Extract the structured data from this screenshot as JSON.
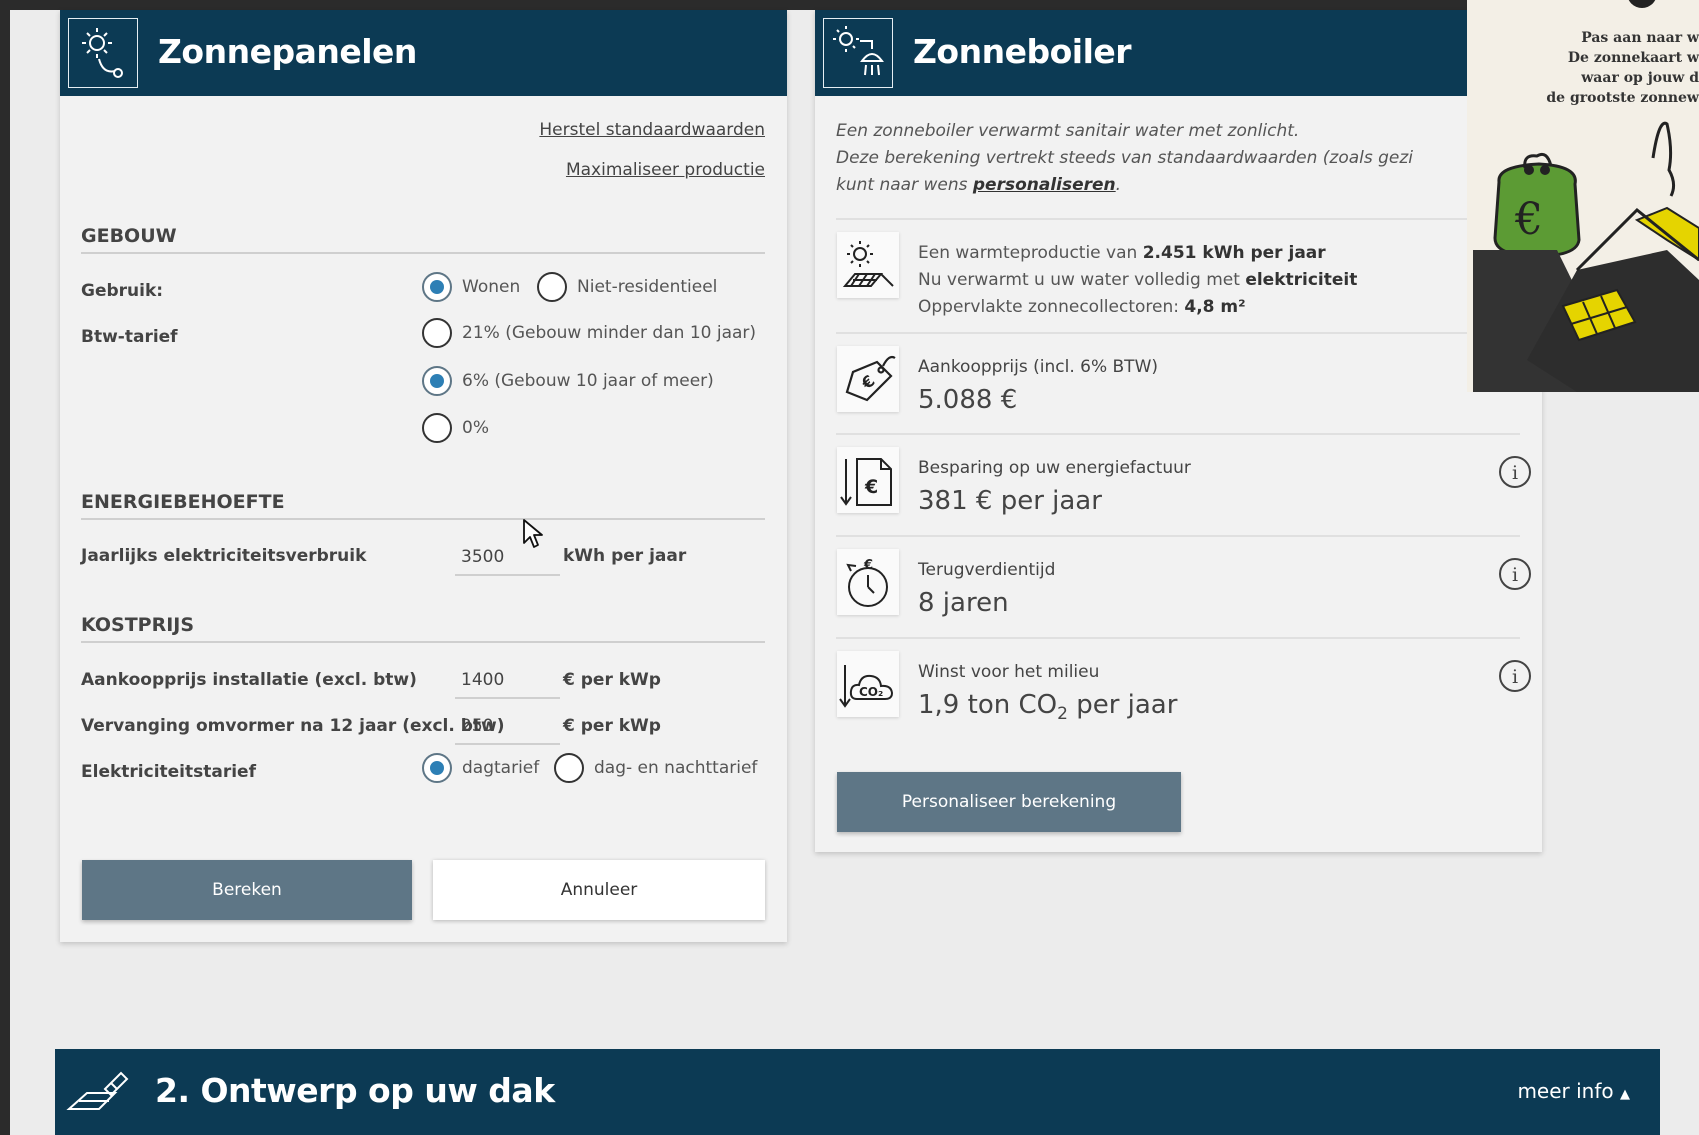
{
  "colors": {
    "navy": "#0c3a54",
    "button_blue": "#5e7686",
    "radio_blue": "#2d7fb5",
    "panel_bg": "#f2f2f2"
  },
  "zonnepanelen": {
    "title": "Zonnepanelen",
    "header_icon": "sun-plug-icon",
    "reset_link": "Herstel standaardwaarden",
    "maximize_link": "Maximaliseer productie",
    "gebouw": {
      "heading": "GEBOUW",
      "usage_label": "Gebruik:",
      "usage_options": [
        "Wonen",
        "Niet-residentieel"
      ],
      "usage_selected": "Wonen",
      "vat_label": "Btw-tarief",
      "vat_options": [
        "21% (Gebouw minder dan 10 jaar)",
        "6% (Gebouw 10 jaar of meer)",
        "0%"
      ],
      "vat_selected": "6% (Gebouw 10 jaar of meer)"
    },
    "energie": {
      "heading": "ENERGIEBEHOEFTE",
      "consumption_label": "Jaarlijks elektriciteitsverbruik",
      "consumption_value": "3500",
      "consumption_unit": "kWh per jaar"
    },
    "kostprijs": {
      "heading": "KOSTPRIJS",
      "install_label": "Aankoopprijs installatie (excl. btw)",
      "install_value": "1400",
      "install_unit": "€ per kWp",
      "inverter_label": "Vervanging omvormer na 12 jaar (excl. btw)",
      "inverter_value": "250",
      "inverter_unit": "€ per kWp",
      "tariff_label": "Elektriciteitstarief",
      "tariff_options": [
        "dagtarief",
        "dag- en nachttarief"
      ],
      "tariff_selected": "dagtarief"
    },
    "calc_button": "Bereken",
    "cancel_button": "Annuleer"
  },
  "zonneboiler": {
    "title": "Zonneboiler",
    "header_icon": "sun-boiler-icon",
    "intro_line1": "Een zonneboiler verwarmt sanitair water met zonlicht.",
    "intro_line2": "Deze berekening vertrekt steeds van standaardwaarden (zoals gezi",
    "intro_line3_prefix": "kunt naar wens ",
    "intro_link": "personaliseren",
    "intro_line3_suffix": ".",
    "production": {
      "icon": "sun-collector-icon",
      "prefix": "Een warmteproductie van ",
      "value": "2.451",
      "unit": "kWh per jaar",
      "heating_prefix": "Nu verwarmt u uw water volledig met ",
      "heating_source": "elektriciteit",
      "area_prefix": "Oppervlakte zonnecollectoren: ",
      "area_value": "4,8",
      "area_unit": "m²"
    },
    "results": [
      {
        "icon": "price-tag-euro-icon",
        "label": "Aankoopprijs (incl. 6% BTW)",
        "value": "5.088  €"
      },
      {
        "icon": "savings-invoice-icon",
        "label": "Besparing op uw energiefactuur",
        "value": "381  € per jaar"
      },
      {
        "icon": "payback-timer-icon",
        "label": "Terugverdientijd",
        "value": "8  jaren"
      }
    ],
    "environment": {
      "icon": "co2-cloud-icon",
      "label": "Winst voor het milieu",
      "value_num": "1,9",
      "value_unit": "ton CO",
      "value_sub": "2",
      "value_suffix": "per jaar"
    },
    "personalize_button": "Personaliseer berekening"
  },
  "section2": {
    "icon": "roof-design-icon",
    "title": "2. Ontwerp op uw dak",
    "more_info": "meer info",
    "toggle_icon": "caret-up-icon"
  },
  "promo": {
    "text_line1": "Pas aan naar w",
    "text_line2": "De zonnekaart w",
    "text_line3": "waar op jouw d",
    "text_line4": "de grootste zonnew",
    "illustration": "wallet-roof-solar-illustration"
  }
}
